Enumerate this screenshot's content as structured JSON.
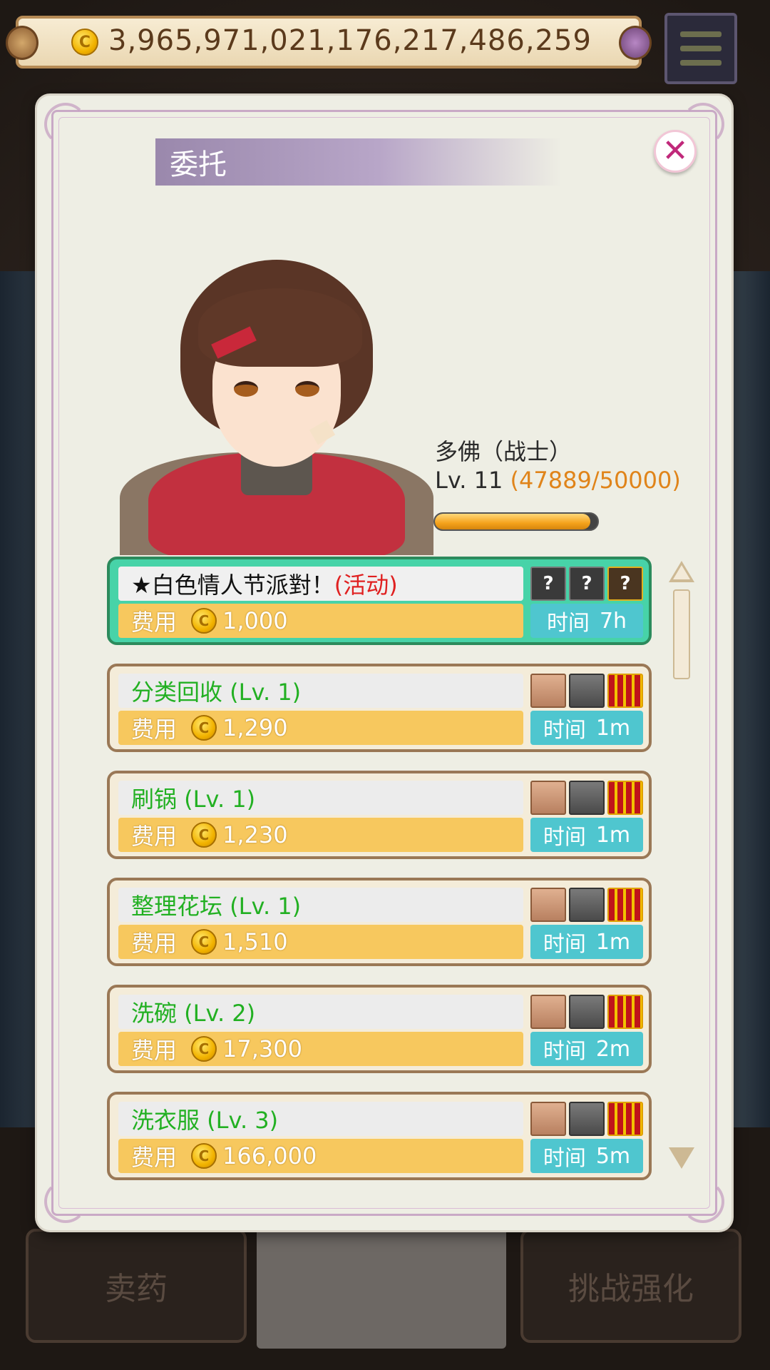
{
  "currency": {
    "amount": "3,965,971,021,176,217,486,259",
    "icon": "gold-coin-icon"
  },
  "dialog": {
    "title": "委托",
    "close_label": "✕"
  },
  "character": {
    "name": "多佛（战士）",
    "level_label": "Lv. 11",
    "xp_text": "(47889/50000)",
    "xp_progress": 0.95778
  },
  "cost_label": "费用",
  "time_label": "时间",
  "quests": [
    {
      "name": "★白色情人节派對！",
      "event_tag": "(活动)",
      "cost": "1,000",
      "time": "7h",
      "active": true,
      "rewards": [
        "unknown-chest-icon",
        "unknown-chest-icon",
        "unknown-gold-chest-icon"
      ],
      "reward_marks": [
        "?",
        "?",
        "?"
      ]
    },
    {
      "name": "分类回收 (Lv. 1)",
      "event_tag": "",
      "cost": "1,290",
      "time": "1m",
      "active": false,
      "rewards": [
        "wood-chest-icon",
        "iron-chest-icon",
        "gold-chest-icon"
      ],
      "reward_marks": [
        "",
        "",
        ""
      ]
    },
    {
      "name": "刷锅 (Lv. 1)",
      "event_tag": "",
      "cost": "1,230",
      "time": "1m",
      "active": false,
      "rewards": [
        "wood-chest-icon",
        "iron-chest-icon",
        "gold-chest-icon"
      ],
      "reward_marks": [
        "",
        "",
        ""
      ]
    },
    {
      "name": "整理花坛 (Lv. 1)",
      "event_tag": "",
      "cost": "1,510",
      "time": "1m",
      "active": false,
      "rewards": [
        "wood-chest-icon",
        "iron-chest-icon",
        "gold-chest-icon"
      ],
      "reward_marks": [
        "",
        "",
        ""
      ]
    },
    {
      "name": "洗碗 (Lv. 2)",
      "event_tag": "",
      "cost": "17,300",
      "time": "2m",
      "active": false,
      "rewards": [
        "wood-chest-icon",
        "iron-chest-icon",
        "gold-chest-icon"
      ],
      "reward_marks": [
        "",
        "",
        ""
      ]
    },
    {
      "name": "洗衣服 (Lv. 3)",
      "event_tag": "",
      "cost": "166,000",
      "time": "5m",
      "active": false,
      "rewards": [
        "wood-chest-icon",
        "iron-chest-icon",
        "gold-chest-icon"
      ],
      "reward_marks": [
        "",
        "",
        ""
      ]
    }
  ],
  "background_buttons": {
    "left": "卖药",
    "right": "挑战强化"
  },
  "colors": {
    "active_quest": "#47d3a8",
    "quest_name_green": "#22b022",
    "event_red": "#e02020",
    "xp_orange": "#e0841a",
    "time_teal": "#4fc6cf"
  }
}
